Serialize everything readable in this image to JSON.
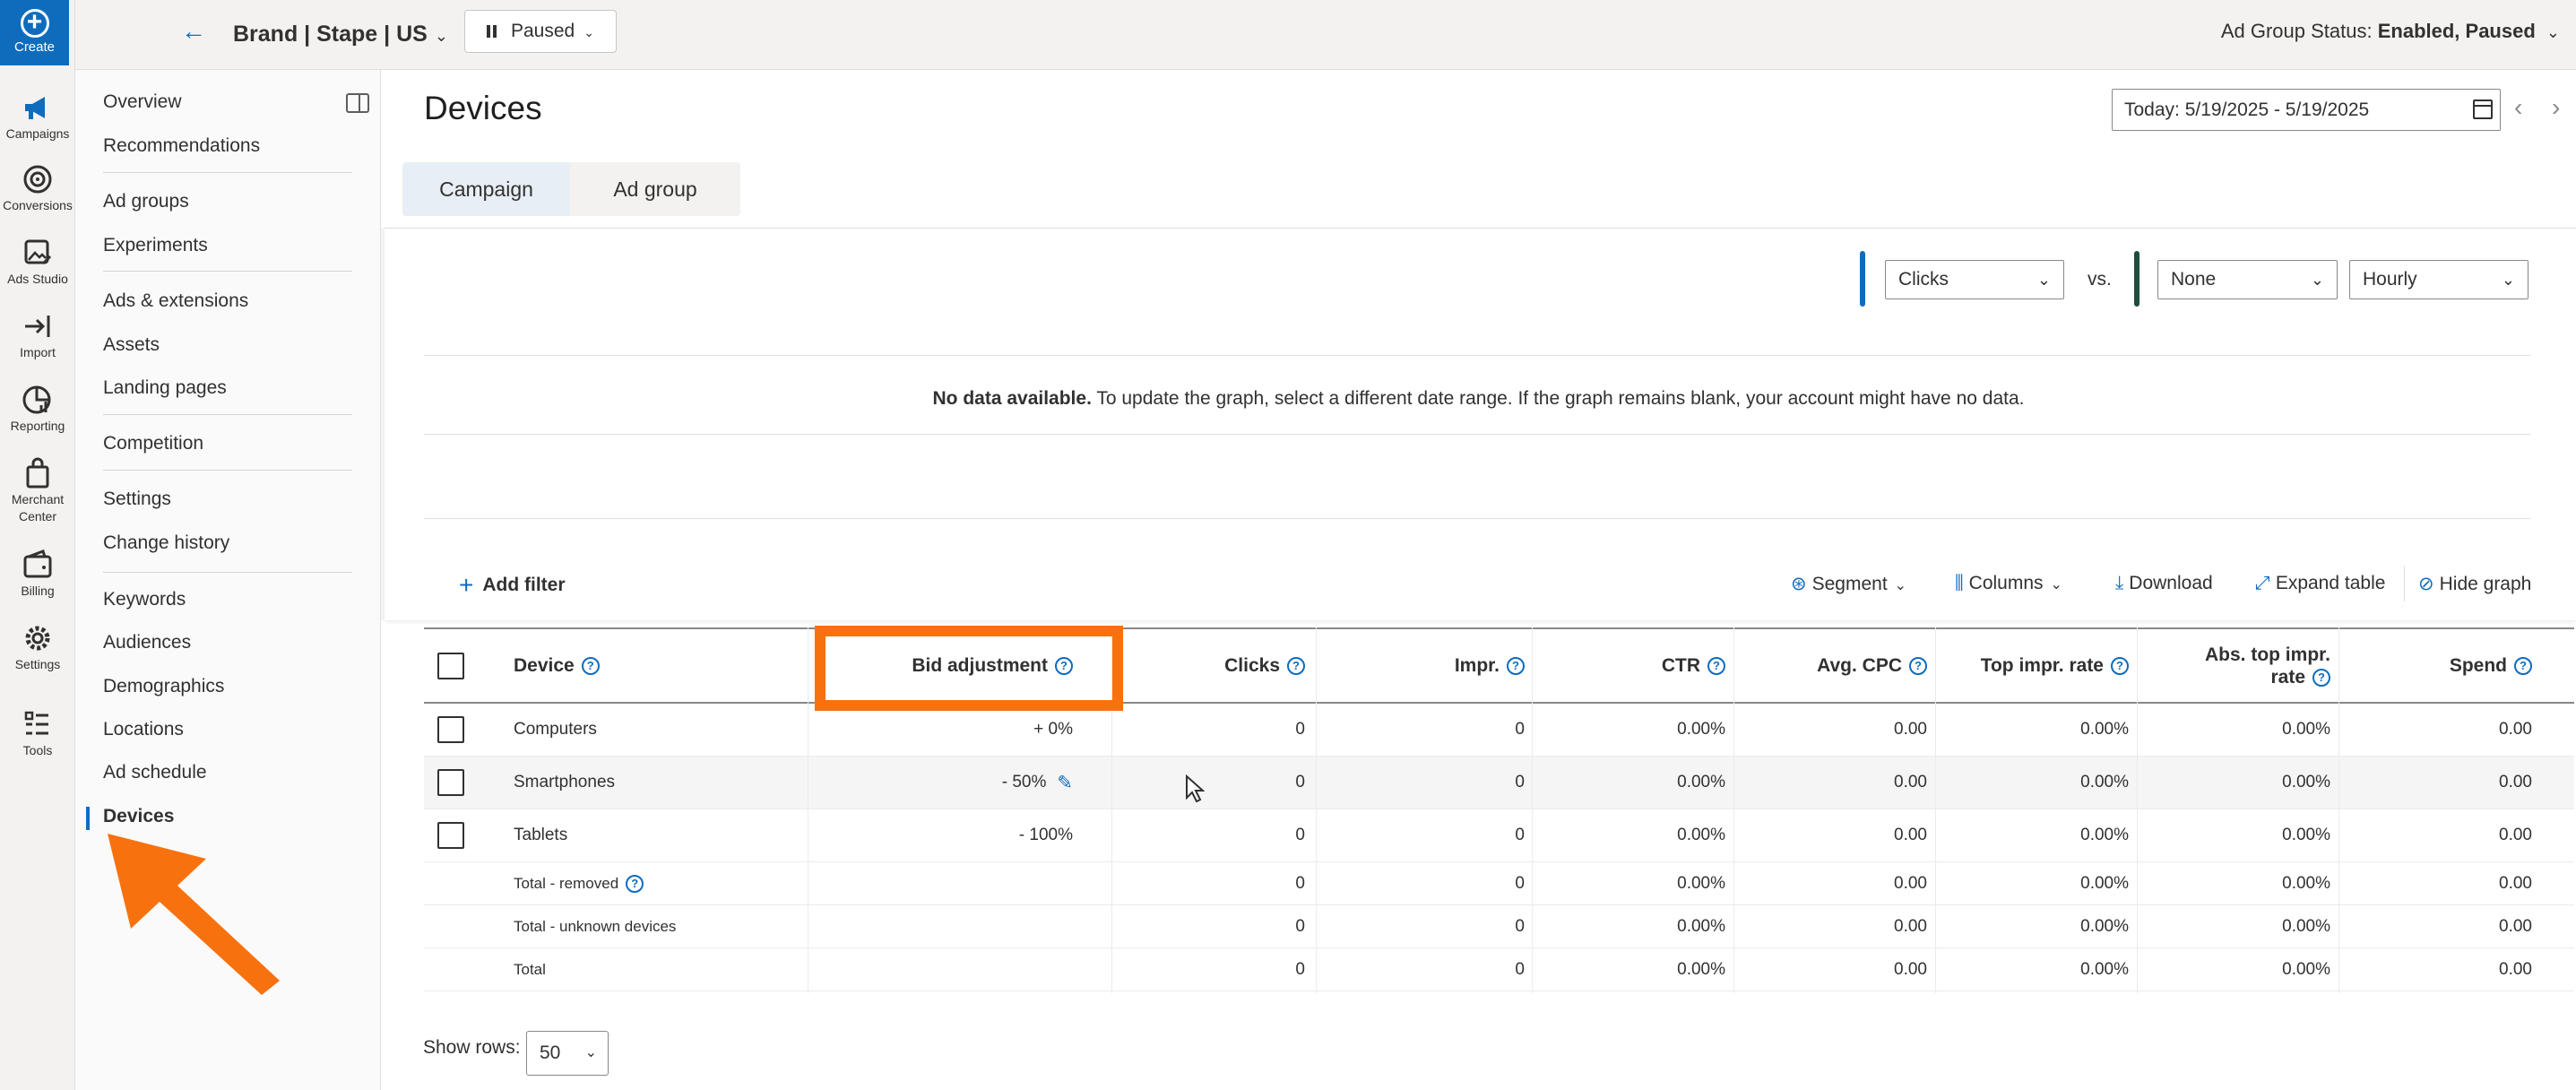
{
  "rail": {
    "create_label": "Create",
    "items": [
      {
        "label": "Campaigns",
        "icon": "megaphone-icon"
      },
      {
        "label": "Conversions",
        "icon": "target-icon"
      },
      {
        "label": "Ads Studio",
        "icon": "image-edit-icon"
      },
      {
        "label": "Import",
        "icon": "import-icon"
      },
      {
        "label": "Reporting",
        "icon": "chart-icon"
      },
      {
        "label": "Merchant Center",
        "icon": "shopping-bag-icon"
      },
      {
        "label": "Billing",
        "icon": "wallet-icon"
      },
      {
        "label": "Settings",
        "icon": "gear-icon"
      },
      {
        "label": "Tools",
        "icon": "tools-icon"
      }
    ]
  },
  "topbar": {
    "campaign_name": "Brand | Stape | US",
    "status": "Paused",
    "ad_group_status_label": "Ad Group Status:",
    "ad_group_status_value": "Enabled, Paused"
  },
  "sidenav": {
    "items": [
      "Overview",
      "Recommendations",
      "Ad groups",
      "Experiments",
      "Ads & extensions",
      "Assets",
      "Landing pages",
      "Competition",
      "Settings",
      "Change history",
      "Keywords",
      "Audiences",
      "Demographics",
      "Locations",
      "Ad schedule",
      "Devices"
    ],
    "active": "Devices"
  },
  "main": {
    "title": "Devices",
    "date_range": "Today: 5/19/2025 - 5/19/2025",
    "tabs": [
      "Campaign",
      "Ad group"
    ],
    "active_tab": "Campaign"
  },
  "graph": {
    "metric1": "Clicks",
    "vs_label": "vs.",
    "metric2": "None",
    "granularity": "Hourly",
    "no_data_bold": "No data available.",
    "no_data_text": " To update the graph, select a different date range. If the graph remains blank, your account might have no data."
  },
  "toolbar": {
    "add_filter": "Add filter",
    "segment": "Segment",
    "columns": "Columns",
    "download": "Download",
    "expand_table": "Expand table",
    "hide_graph": "Hide graph"
  },
  "table": {
    "headers": {
      "device": "Device",
      "bid_adjustment": "Bid adjustment",
      "clicks": "Clicks",
      "impr": "Impr.",
      "ctr": "CTR",
      "avg_cpc": "Avg. CPC",
      "top_impr_rate": "Top impr. rate",
      "abs_top_impr_rate_1": "Abs. top impr.",
      "abs_top_impr_rate_2": "rate",
      "spend": "Spend"
    },
    "rows": [
      {
        "device": "Computers",
        "bid": "+ 0%",
        "clicks": "0",
        "impr": "0",
        "ctr": "0.00%",
        "cpc": "0.00",
        "top": "0.00%",
        "abs": "0.00%",
        "spend": "0.00"
      },
      {
        "device": "Smartphones",
        "bid": "- 50%",
        "clicks": "0",
        "impr": "0",
        "ctr": "0.00%",
        "cpc": "0.00",
        "top": "0.00%",
        "abs": "0.00%",
        "spend": "0.00"
      },
      {
        "device": "Tablets",
        "bid": "- 100%",
        "clicks": "0",
        "impr": "0",
        "ctr": "0.00%",
        "cpc": "0.00",
        "top": "0.00%",
        "abs": "0.00%",
        "spend": "0.00"
      }
    ],
    "totals": [
      {
        "label": "Total - removed",
        "clicks": "0",
        "impr": "0",
        "ctr": "0.00%",
        "cpc": "0.00",
        "top": "0.00%",
        "abs": "0.00%",
        "spend": "0.00"
      },
      {
        "label": "Total - unknown devices",
        "clicks": "0",
        "impr": "0",
        "ctr": "0.00%",
        "cpc": "0.00",
        "top": "0.00%",
        "abs": "0.00%",
        "spend": "0.00"
      },
      {
        "label": "Total",
        "clicks": "0",
        "impr": "0",
        "ctr": "0.00%",
        "cpc": "0.00",
        "top": "0.00%",
        "abs": "0.00%",
        "spend": "0.00"
      }
    ]
  },
  "footer": {
    "show_rows_label": "Show rows:",
    "show_rows_value": "50"
  },
  "colors": {
    "accent": "#0f6cbd",
    "annotation": "#f7720f"
  }
}
